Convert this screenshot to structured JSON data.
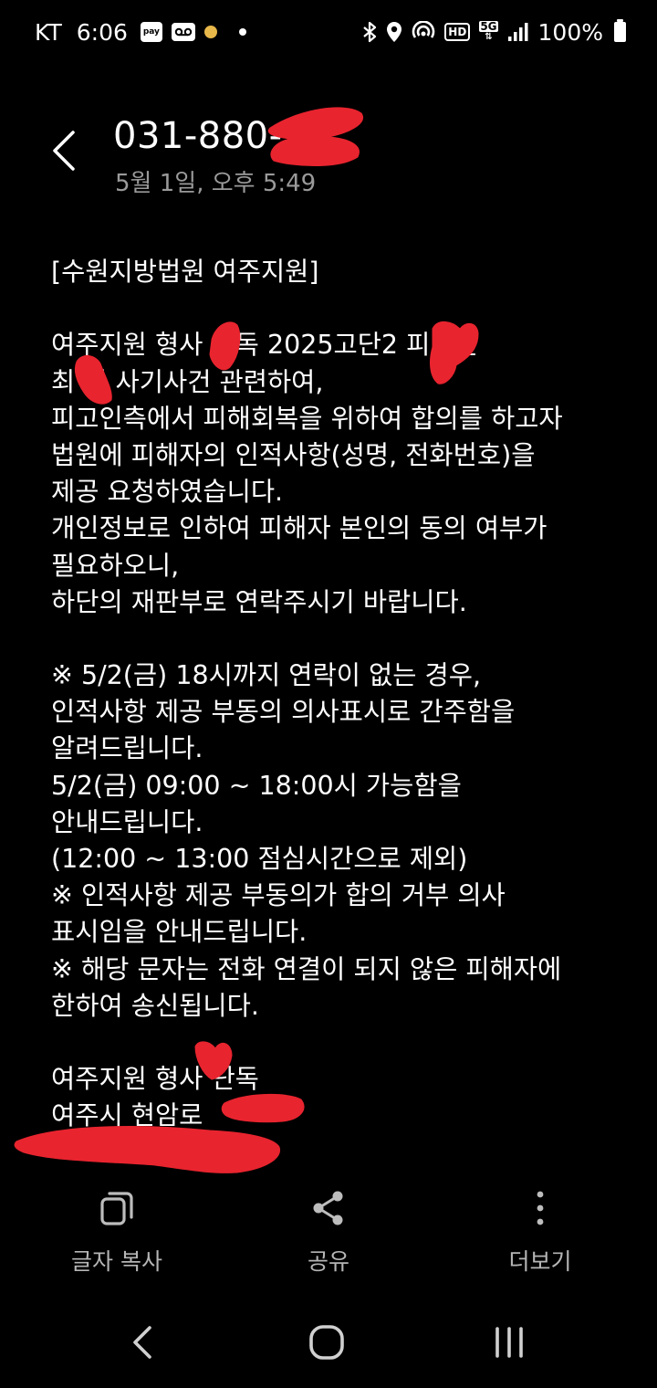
{
  "status_bar": {
    "carrier": "KT",
    "time": "6:06",
    "pay_badge": "pay",
    "signal_type": "5G",
    "hd_badge": "HD",
    "battery": "100%",
    "icons": [
      "samsung-pay-icon",
      "voicemail-icon",
      "emoji-icon",
      "notification-dot-icon",
      "bluetooth-icon",
      "location-icon",
      "hotspot-icon",
      "hd-voice-icon",
      "5g-icon",
      "signal-icon",
      "battery-icon"
    ]
  },
  "header": {
    "sender_number": "031-880-",
    "timestamp": "5월 1일, 오후 5:49"
  },
  "message": {
    "lines": [
      "[수원지방법원 여주지원]",
      "",
      "여주지원 형사    단독 2025고단2     피고인",
      "최    민 사기사건 관련하여,",
      "피고인측에서 피해회복을 위하여 합의를 하고자",
      "법원에 피해자의 인적사항(성명, 전화번호)을",
      "제공 요청하였습니다.",
      "개인정보로 인하여 피해자 본인의 동의 여부가",
      "필요하오니,",
      "하단의 재판부로 연락주시기 바랍니다.",
      "",
      "※ 5/2(금) 18시까지 연락이 없는 경우,",
      "인적사항 제공 부동의 의사표시로 간주함을",
      "알려드립니다.",
      "5/2(금) 09:00 ~ 18:00시 가능함을",
      "안내드립니다.",
      "(12:00 ~ 13:00 점심시간으로 제외)",
      "※ 인적사항 제공 부동의가 합의 거부 의사",
      "표시임을 안내드립니다.",
      "※ 해당 문자는 전화 연결이 되지 않은 피해자에",
      "한하여 송신됩니다.",
      "",
      "여주지원 형사    단독",
      "여주시 현암로"
    ]
  },
  "actions": {
    "copy_label": "글자 복사",
    "share_label": "공유",
    "more_label": "더보기"
  },
  "colors": {
    "background": "#000000",
    "text": "#ffffff",
    "muted": "#9a9a9a",
    "redaction": "#e8242f"
  }
}
